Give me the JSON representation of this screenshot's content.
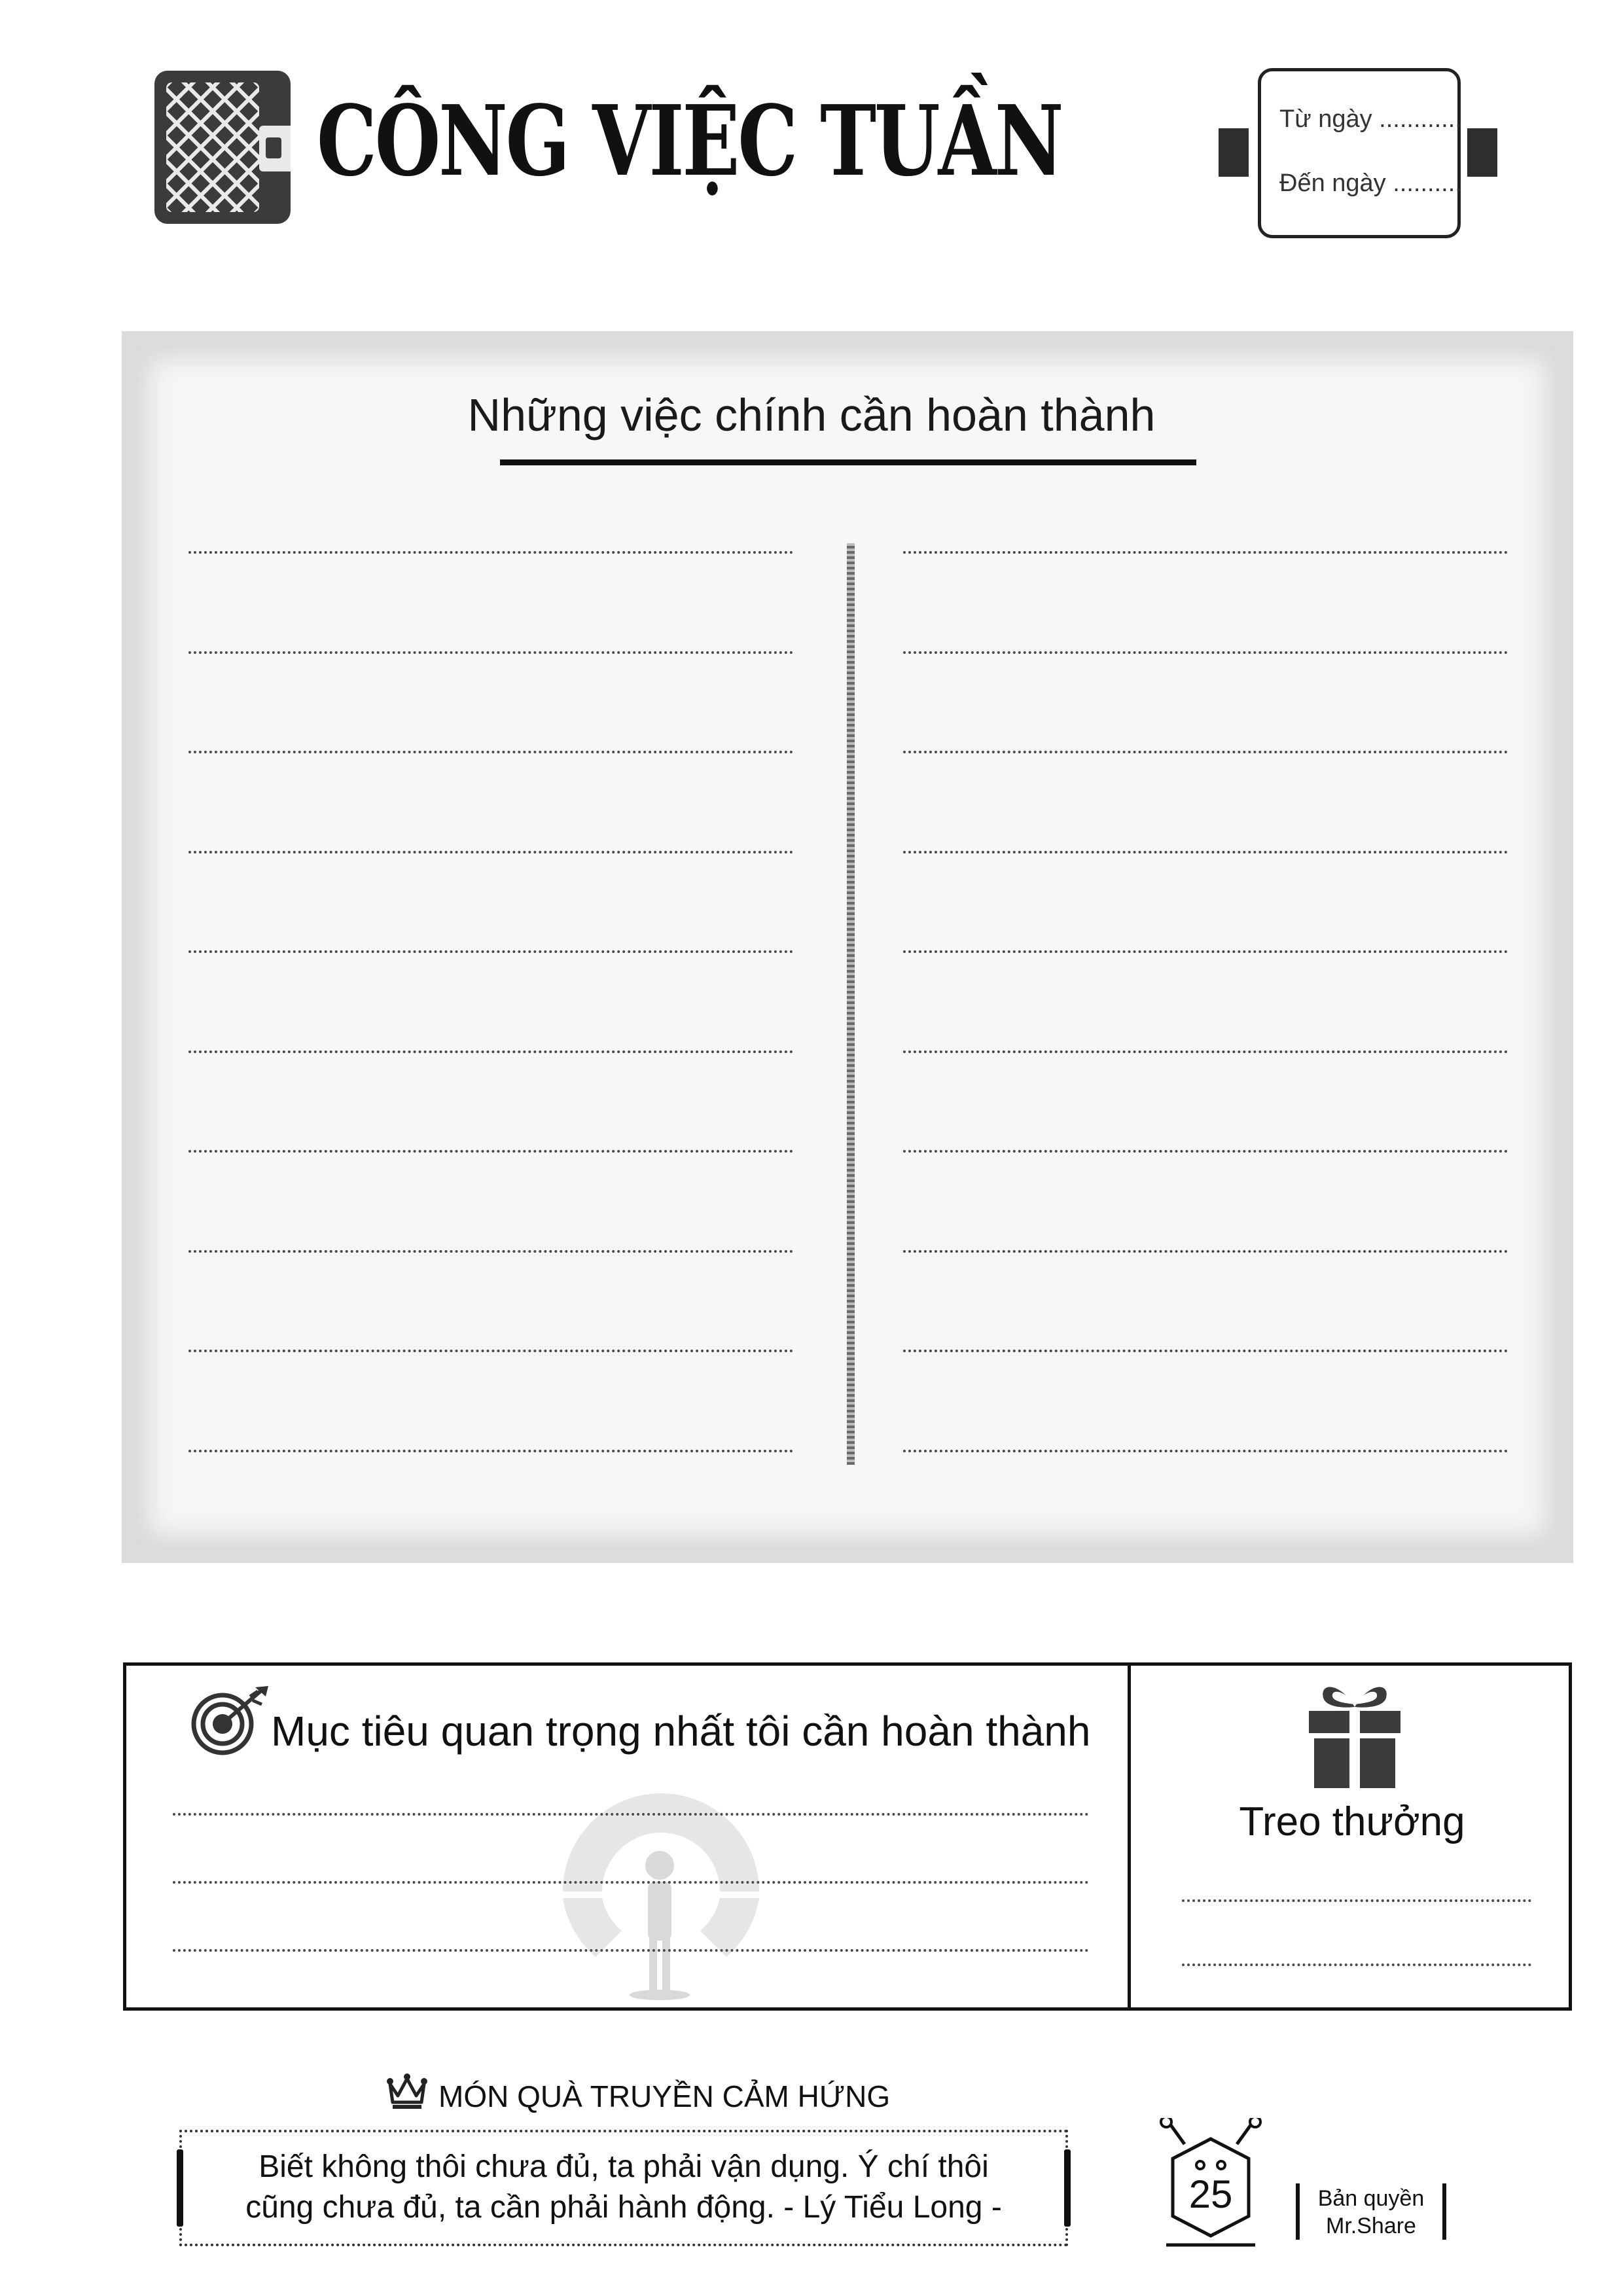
{
  "header": {
    "title": "CÔNG VIỆC TUẦN",
    "from_date_label": "Từ ngày ............",
    "to_date_label": "Đến ngày .........."
  },
  "main_tasks": {
    "title": "Những việc chính cần hoàn thành",
    "left_column_lines": 10,
    "right_column_lines": 10
  },
  "goal": {
    "title": "Mục tiêu quan trọng nhất tôi cần hoàn thành",
    "lines": 3
  },
  "reward": {
    "label": "Treo thưởng",
    "lines": 2
  },
  "inspiration": {
    "title": "MÓN QUÀ TRUYỀN CẢM HỨNG",
    "quote_line_1": "Biết không thôi chưa đủ, ta phải vận dụng. Ý chí thôi",
    "quote_line_2": "cũng chưa đủ, ta cần phải hành động. - Lý Tiểu Long -"
  },
  "page_number": "25",
  "copyright": {
    "line1": "Bản quyền",
    "line2": "Mr.Share"
  },
  "icons": [
    "wallet-icon",
    "target-icon",
    "gift-icon",
    "crown-icon",
    "page-badge-icon"
  ],
  "colors": {
    "ink": "#111111",
    "panel_frame": "#dcdcdc",
    "panel_fill": "#f7f7f7",
    "icon_dark": "#3b3b3b"
  }
}
